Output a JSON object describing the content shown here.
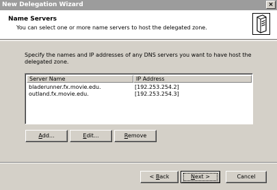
{
  "window": {
    "title": "New Delegation Wizard",
    "close_glyph": "×"
  },
  "header": {
    "title": "Name Servers",
    "subtitle": "You can select one or more name servers to host the delegated zone.",
    "icon": "server-icon"
  },
  "instruction": "Specify the names and IP addresses of any DNS servers you want to have host the delegated zone.",
  "servers_list": {
    "columns": [
      "Server Name",
      "IP Address"
    ],
    "rows": [
      {
        "name": "bladerunner.fx.movie.edu.",
        "ip": "[192.253.254.2]"
      },
      {
        "name": "outland.fx.movie.edu.",
        "ip": "[192.253.254.3]"
      }
    ]
  },
  "list_buttons": {
    "add": {
      "mnemonic": "A",
      "rest": "dd..."
    },
    "edit": {
      "mnemonic": "E",
      "rest": "dit..."
    },
    "remove": {
      "mnemonic": "R",
      "rest": "emove"
    }
  },
  "nav_buttons": {
    "back": {
      "prefix": "< ",
      "mnemonic": "B",
      "rest": "ack"
    },
    "next": {
      "mnemonic": "N",
      "rest": "ext >"
    },
    "cancel": "Cancel"
  }
}
